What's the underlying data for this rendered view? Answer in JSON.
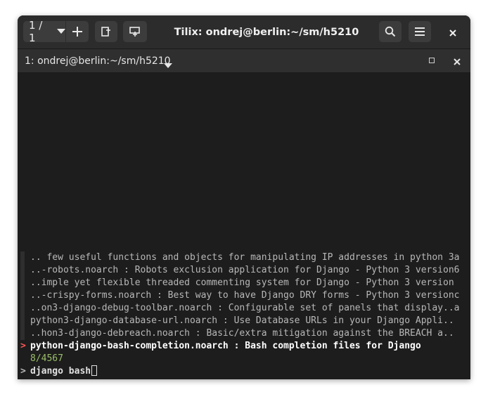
{
  "headerbar": {
    "sessions_label": "1 / 1",
    "title": "Tilix: ondrej@berlin:~/sm/h5210"
  },
  "terminal_bar": {
    "title": "1: ondrej@berlin:~/sm/h5210"
  },
  "fzf": {
    "results": [
      ".. few useful functions and objects for manipulating IP addresses in python 3a",
      "..-robots.noarch : Robots exclusion application for Django - Python 3 version6",
      "..imple yet flexible threaded commenting system for Django - Python 3 version",
      "..-crispy-forms.noarch : Best way to have Django DRY forms - Python 3 versionc",
      "..on3-django-debug-toolbar.noarch : Configurable set of panels that display..a",
      "python3-django-database-url.noarch : Use Database URLs in your Django Appli..",
      "..hon3-django-debreach.noarch : Basic/extra mitigation against the BREACH a.."
    ],
    "selected": "python-django-bash-completion.noarch : Bash completion files for Django",
    "selected_marker": ">",
    "count": "8/4567",
    "prompt_marker": ">",
    "query": "django bash"
  },
  "colors": {
    "window_bg": "#1d1d1d",
    "headerbar_bg": "#2c2c2c",
    "marker": "#ff5555",
    "count": "#9bbf6a"
  }
}
